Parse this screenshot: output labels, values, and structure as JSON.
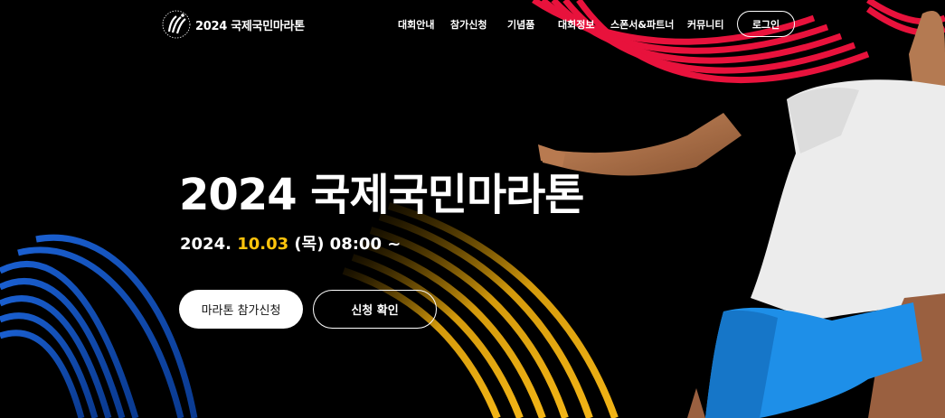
{
  "logo": {
    "text": "2024 국제국민마라톤"
  },
  "nav": {
    "items": [
      {
        "label": "대회안내"
      },
      {
        "label": "참가신청"
      },
      {
        "label": "기념품"
      },
      {
        "label": "대회정보"
      },
      {
        "label": "스폰서&파트너"
      },
      {
        "label": "커뮤니티"
      }
    ],
    "login_label": "로그인"
  },
  "hero": {
    "title": "2024 국제국민마라톤",
    "date_prefix": "2024. ",
    "date_highlight": "10.03",
    "date_suffix": " (목) 08:00 ~",
    "apply_button": "마라톤 참가신청",
    "check_button": "신청 확인"
  },
  "colors": {
    "background": "#000000",
    "accent": "#ffc40c",
    "red_stripe": "#e8123c",
    "blue_stripe": "#1565d8",
    "shorts_blue": "#1e8fe8"
  }
}
